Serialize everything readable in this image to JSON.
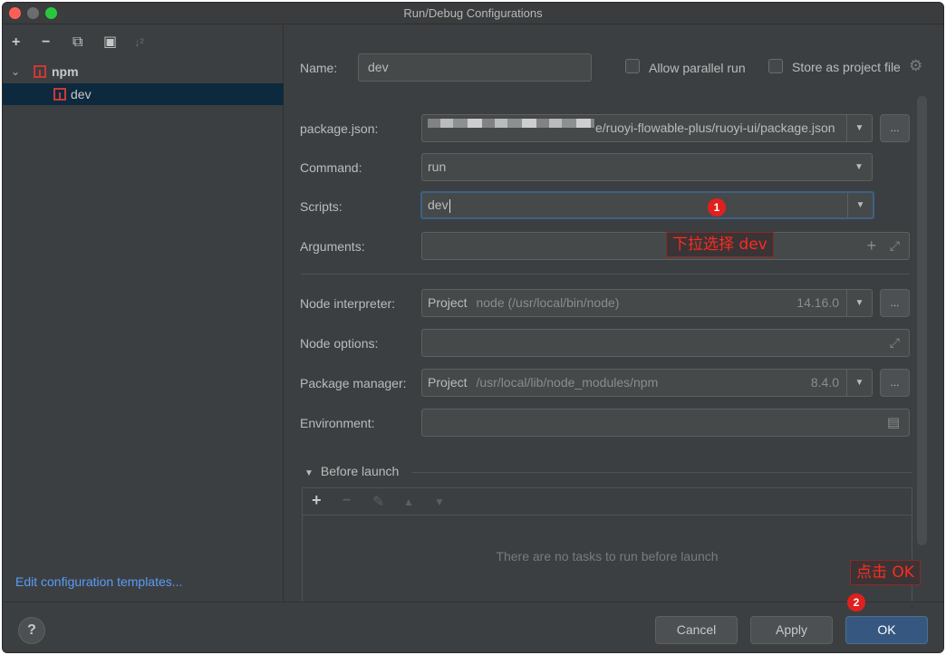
{
  "window": {
    "title": "Run/Debug Configurations"
  },
  "left": {
    "toolbar": {
      "add": "+",
      "remove": "−",
      "copy": "⧉",
      "folder": "▣",
      "sort": "↓²"
    },
    "tree": [
      {
        "label": "npm",
        "expanded": true
      },
      {
        "label": "dev",
        "selected": true
      }
    ],
    "edit_templates": "Edit configuration templates..."
  },
  "form": {
    "name_label": "Name:",
    "name_value": "dev",
    "allow_parallel": "Allow parallel run",
    "store_project": "Store as project file",
    "package_label": "package.json:",
    "package_value": "e/ruoyi-flowable-plus/ruoyi-ui/package.json",
    "command_label": "Command:",
    "command_value": "run",
    "scripts_label": "Scripts:",
    "scripts_value": "dev",
    "arguments_label": "Arguments:",
    "node_interp_label": "Node interpreter:",
    "node_interp_project": "Project",
    "node_interp_path": "node (/usr/local/bin/node)",
    "node_interp_version": "14.16.0",
    "node_options_label": "Node options:",
    "pkg_manager_label": "Package manager:",
    "pkg_manager_project": "Project",
    "pkg_manager_path": "/usr/local/lib/node_modules/npm",
    "pkg_manager_version": "8.4.0",
    "environment_label": "Environment:",
    "browse": "...",
    "before_launch": "Before launch",
    "before_launch_empty": "There are no tasks to run before launch"
  },
  "footer": {
    "help": "?",
    "cancel": "Cancel",
    "apply": "Apply",
    "ok": "OK"
  },
  "annotations": {
    "badge1": "1",
    "note1": "下拉选择 dev",
    "badge2": "2",
    "note2": "点击 OK"
  },
  "colors": {
    "accent": "#365880",
    "link": "#589df6",
    "annotation": "#ff2a1e"
  }
}
